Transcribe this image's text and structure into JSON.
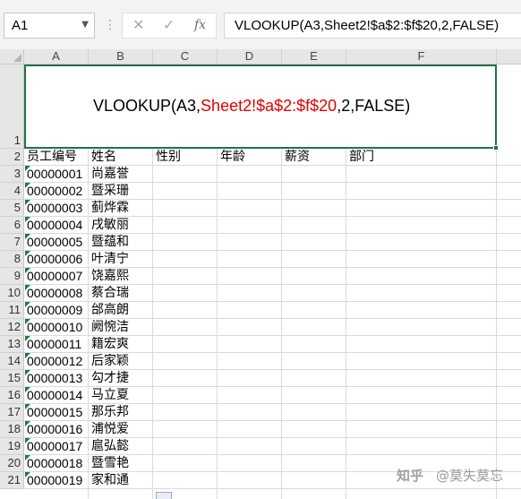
{
  "name_box": {
    "value": "A1"
  },
  "formula_bar": {
    "fx_label": "fx",
    "formula": "VLOOKUP(A3,Sheet2!$a$2:$f$20,2,FALSE)"
  },
  "columns": [
    "A",
    "B",
    "C",
    "D",
    "E",
    "F"
  ],
  "merged_cell": {
    "part1": "VLOOKUP(A3,",
    "part2": "Sheet2!$a$2:$f$20",
    "part3": ",2,FALSE)",
    "highlight_color": "#e00000"
  },
  "headers": [
    "员工编号",
    "姓名",
    "性别",
    "年龄",
    "薪资",
    "部门"
  ],
  "rows": [
    {
      "row": "3",
      "id": "00000001",
      "name": "尚嘉誉"
    },
    {
      "row": "4",
      "id": "00000002",
      "name": "暨采珊"
    },
    {
      "row": "5",
      "id": "00000003",
      "name": "蓟烨霖"
    },
    {
      "row": "6",
      "id": "00000004",
      "name": "戌敏丽"
    },
    {
      "row": "7",
      "id": "00000005",
      "name": "暨蕴和"
    },
    {
      "row": "8",
      "id": "00000006",
      "name": "叶清宁"
    },
    {
      "row": "9",
      "id": "00000007",
      "name": "饶嘉熙"
    },
    {
      "row": "10",
      "id": "00000008",
      "name": "蔡合瑞"
    },
    {
      "row": "11",
      "id": "00000009",
      "name": "邰高朗"
    },
    {
      "row": "12",
      "id": "00000010",
      "name": "阙惋洁"
    },
    {
      "row": "13",
      "id": "00000011",
      "name": "籍宏爽"
    },
    {
      "row": "14",
      "id": "00000012",
      "name": "后家颖"
    },
    {
      "row": "15",
      "id": "00000013",
      "name": "勾才捷"
    },
    {
      "row": "16",
      "id": "00000014",
      "name": "马立夏"
    },
    {
      "row": "17",
      "id": "00000015",
      "name": "那乐邦"
    },
    {
      "row": "18",
      "id": "00000016",
      "name": "浦悦爱"
    },
    {
      "row": "19",
      "id": "00000017",
      "name": "扈弘懿"
    },
    {
      "row": "20",
      "id": "00000018",
      "name": "暨雪艳"
    },
    {
      "row": "21",
      "id": "00000019",
      "name": "家和通"
    }
  ],
  "watermark": {
    "logo": "知乎",
    "author": "@莫失莫忘"
  },
  "colors": {
    "accent": "#217346",
    "header_bg": "#e6e6e6",
    "grid": "#dadada"
  }
}
